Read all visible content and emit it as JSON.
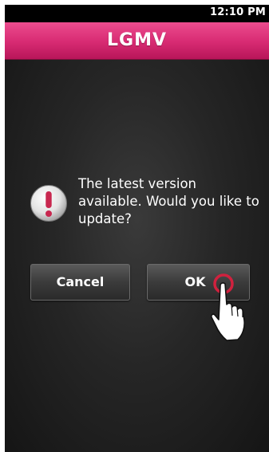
{
  "status_bar": {
    "time": "12:10 PM"
  },
  "header": {
    "title": "LGMV"
  },
  "dialog": {
    "message": "The latest version available. Would you like to update?",
    "icon": "alert-exclamation-icon",
    "buttons": {
      "cancel": "Cancel",
      "ok": "OK"
    }
  },
  "overlay": {
    "pointer_icon": "tap-hand-icon"
  },
  "colors": {
    "header": "#d72a72",
    "background": "#262626",
    "tap_ring": "#d0213e"
  }
}
